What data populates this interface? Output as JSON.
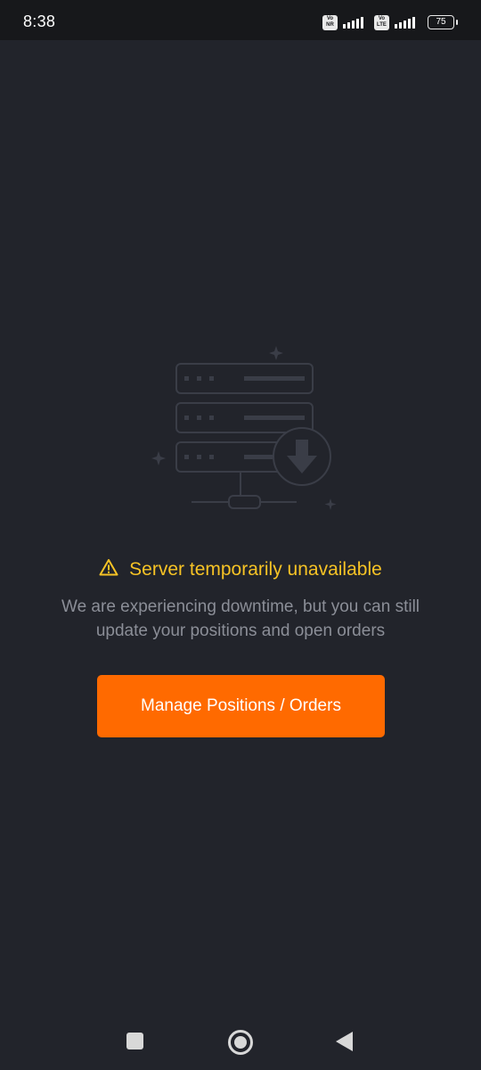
{
  "status_bar": {
    "time": "8:38",
    "sim1_badge": [
      "Vo",
      "NR"
    ],
    "sim2_badge": [
      "Vo",
      "LTE"
    ],
    "battery": "75"
  },
  "illustration": {
    "icon": "server-download-icon"
  },
  "error": {
    "icon": "warning-triangle-icon",
    "title": "Server temporarily unavailable",
    "message": "We are experiencing downtime, but you can still update your positions and open orders"
  },
  "actions": {
    "manage_label": "Manage Positions / Orders"
  },
  "colors": {
    "background": "#22242b",
    "warning": "#f7c325",
    "accent": "#ff6a00",
    "muted_text": "#8b8e97"
  },
  "nav_bar": {
    "icons": [
      "recents-square-icon",
      "home-circle-icon",
      "back-triangle-icon"
    ]
  }
}
